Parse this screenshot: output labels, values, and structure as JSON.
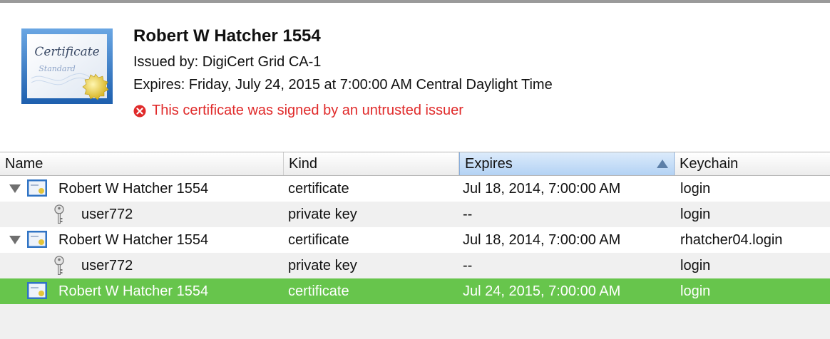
{
  "detail": {
    "title": "Robert W Hatcher 1554",
    "issued_by": "Issued by: DigiCert Grid CA-1",
    "expires": "Expires: Friday, July 24, 2015 at 7:00:00 AM Central Daylight Time",
    "warning": "This certificate was signed by an untrusted issuer",
    "icon": {
      "name": "certificate-standard-icon",
      "line1": "Certificate",
      "line2": "Standard"
    }
  },
  "colors": {
    "warning": "#e02a2a",
    "selected_row": "#67c54c",
    "sorted_header": "#b3d2f4"
  },
  "table": {
    "columns": [
      {
        "label": "Name"
      },
      {
        "label": "Kind"
      },
      {
        "label": "Expires",
        "sorted": true,
        "sort_direction": "ascending"
      },
      {
        "label": "Keychain"
      }
    ],
    "rows": [
      {
        "name": "Robert W Hatcher 1554",
        "kind": "certificate",
        "expires": "Jul 18, 2014, 7:00:00 AM",
        "keychain": "login",
        "icon": "certificate-icon",
        "expanded": true
      },
      {
        "name": "user772",
        "kind": "private key",
        "expires": "--",
        "keychain": "login",
        "icon": "key-icon"
      },
      {
        "name": "Robert W Hatcher 1554",
        "kind": "certificate",
        "expires": "Jul 18, 2014, 7:00:00 AM",
        "keychain": "rhatcher04.login",
        "icon": "certificate-icon",
        "expanded": true
      },
      {
        "name": "user772",
        "kind": "private key",
        "expires": "--",
        "keychain": "login",
        "icon": "key-icon"
      },
      {
        "name": "Robert W Hatcher 1554",
        "kind": "certificate",
        "expires": "Jul 24, 2015, 7:00:00 AM",
        "keychain": "login",
        "icon": "certificate-icon",
        "selected": true
      }
    ]
  }
}
